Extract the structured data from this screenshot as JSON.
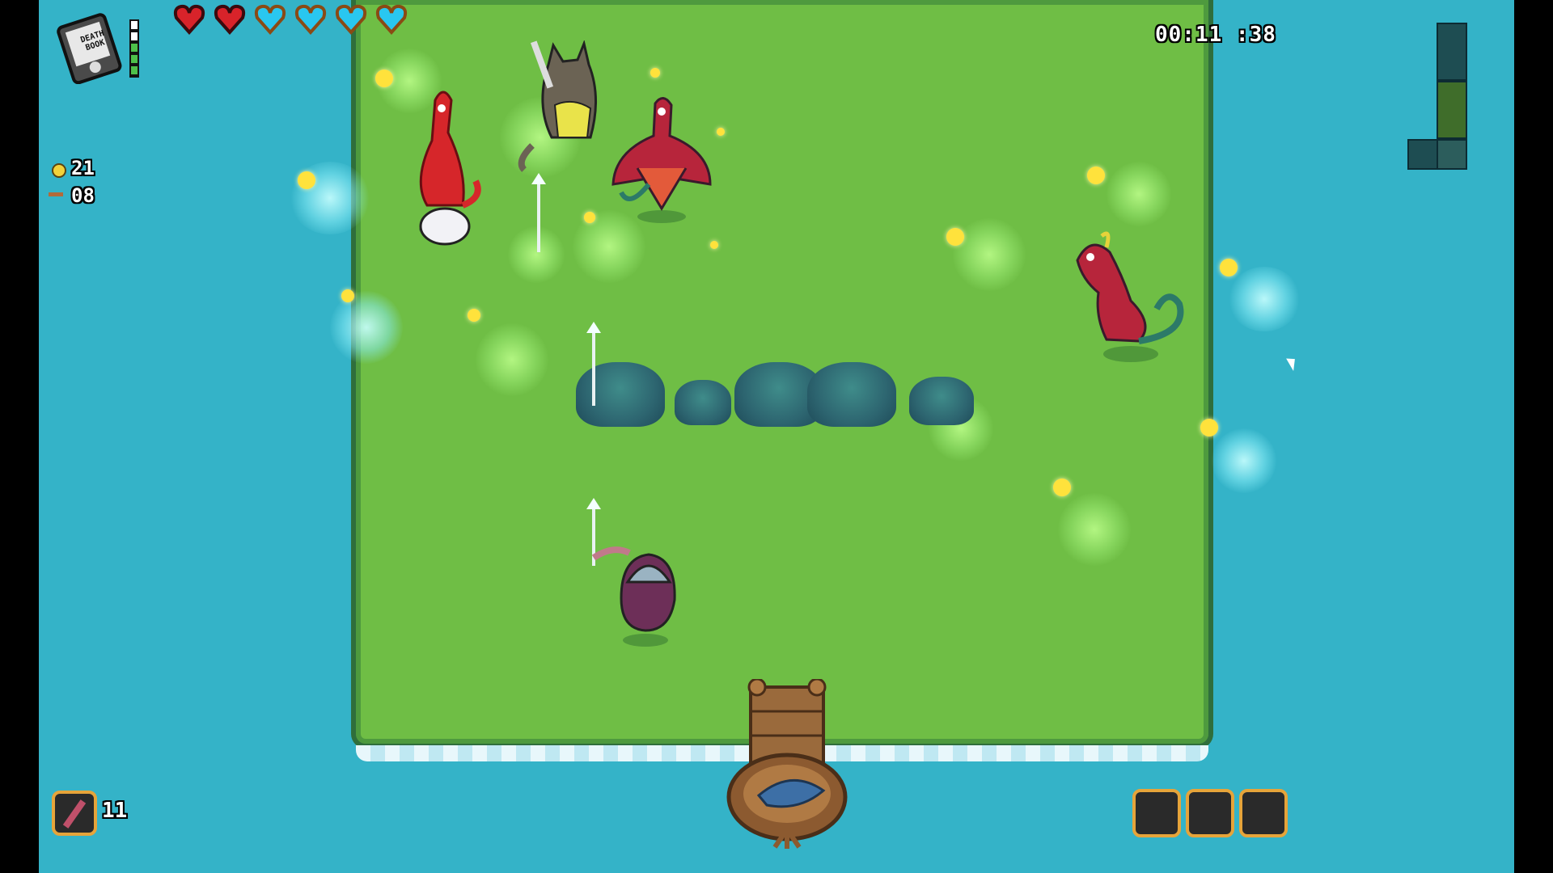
{
  "hud": {
    "timer": "00:11 :38",
    "coins": "21",
    "keys": "08",
    "weapon_count": "11",
    "book_title": "DEATH BOOK",
    "hearts": [
      {
        "type": "red"
      },
      {
        "type": "red"
      },
      {
        "type": "blue"
      },
      {
        "type": "blue"
      },
      {
        "type": "blue"
      },
      {
        "type": "blue"
      }
    ],
    "energy_bars": 5,
    "item_slots": 3
  },
  "colors": {
    "water": "#34b3c8",
    "grass": "#6fbe45",
    "heart_red": "#d8232a",
    "heart_blue": "#29c7f0",
    "slot_border": "#e6a43a"
  }
}
